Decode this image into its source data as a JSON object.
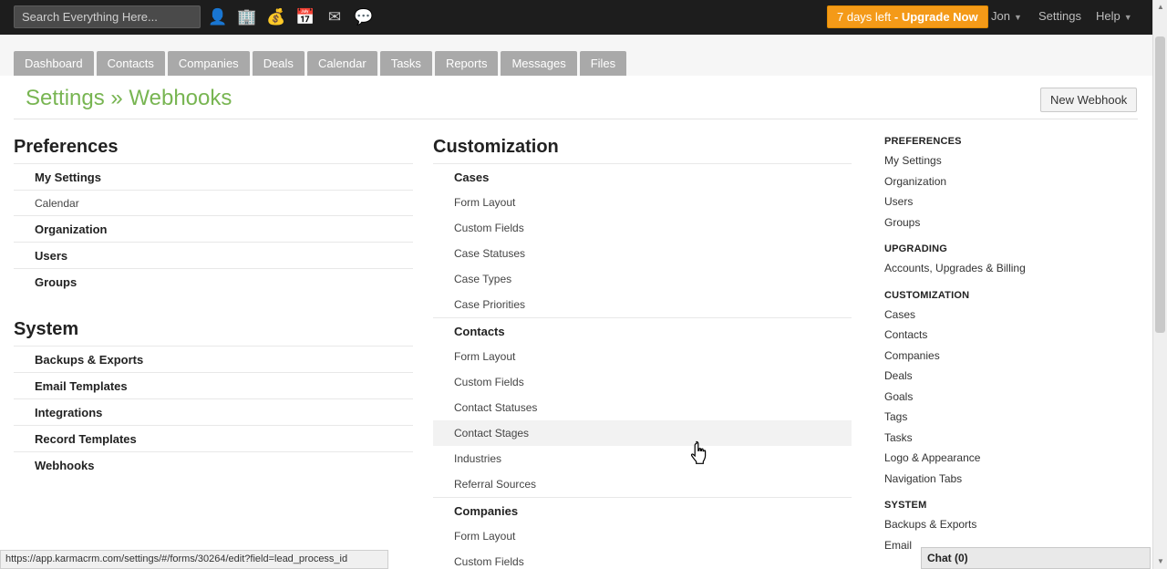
{
  "topbar": {
    "search_placeholder": "Search Everything Here...",
    "icons": [
      "person-icon",
      "building-icon",
      "money-bag-icon",
      "calendar-icon",
      "mail-icon",
      "chat-icon"
    ],
    "trial_days": "7 days left",
    "trial_sep": " - ",
    "upgrade_label": "Upgrade Now",
    "user": "Jon",
    "settings": "Settings",
    "help": "Help"
  },
  "tabs": [
    "Dashboard",
    "Contacts",
    "Companies",
    "Deals",
    "Calendar",
    "Tasks",
    "Reports",
    "Messages",
    "Files"
  ],
  "page": {
    "title": "Settings » Webhooks",
    "new_button": "New Webhook"
  },
  "left": {
    "preferences": {
      "heading": "Preferences",
      "items": [
        {
          "label": "My Settings",
          "bold": true
        },
        {
          "label": "Calendar",
          "bold": false
        },
        {
          "label": "Organization",
          "bold": true
        },
        {
          "label": "Users",
          "bold": true
        },
        {
          "label": "Groups",
          "bold": true
        }
      ]
    },
    "system": {
      "heading": "System",
      "items": [
        "Backups & Exports",
        "Email Templates",
        "Integrations",
        "Record Templates",
        "Webhooks"
      ]
    }
  },
  "customization": {
    "heading": "Customization",
    "groups": [
      {
        "name": "Cases",
        "items": [
          "Form Layout",
          "Custom Fields",
          "Case Statuses",
          "Case Types",
          "Case Priorities"
        ]
      },
      {
        "name": "Contacts",
        "items": [
          "Form Layout",
          "Custom Fields",
          "Contact Statuses",
          "Contact Stages",
          "Industries",
          "Referral Sources"
        ]
      },
      {
        "name": "Companies",
        "items": [
          "Form Layout",
          "Custom Fields"
        ]
      }
    ]
  },
  "sidebar": {
    "sections": [
      {
        "heading": "PREFERENCES",
        "items": [
          "My Settings",
          "Organization",
          "Users",
          "Groups"
        ]
      },
      {
        "heading": "UPGRADING",
        "items": [
          "Accounts, Upgrades & Billing"
        ]
      },
      {
        "heading": "CUSTOMIZATION",
        "items": [
          "Cases",
          "Contacts",
          "Companies",
          "Deals",
          "Goals",
          "Tags",
          "Tasks",
          "Logo & Appearance",
          "Navigation Tabs"
        ]
      },
      {
        "heading": "SYSTEM",
        "items": [
          "Backups & Exports",
          "Email"
        ]
      }
    ]
  },
  "status_url": "https://app.karmacrm.com/settings/#/forms/30264/edit?field=lead_process_id",
  "chat_label": "Chat (0)",
  "hovered_item": "Contact Stages"
}
